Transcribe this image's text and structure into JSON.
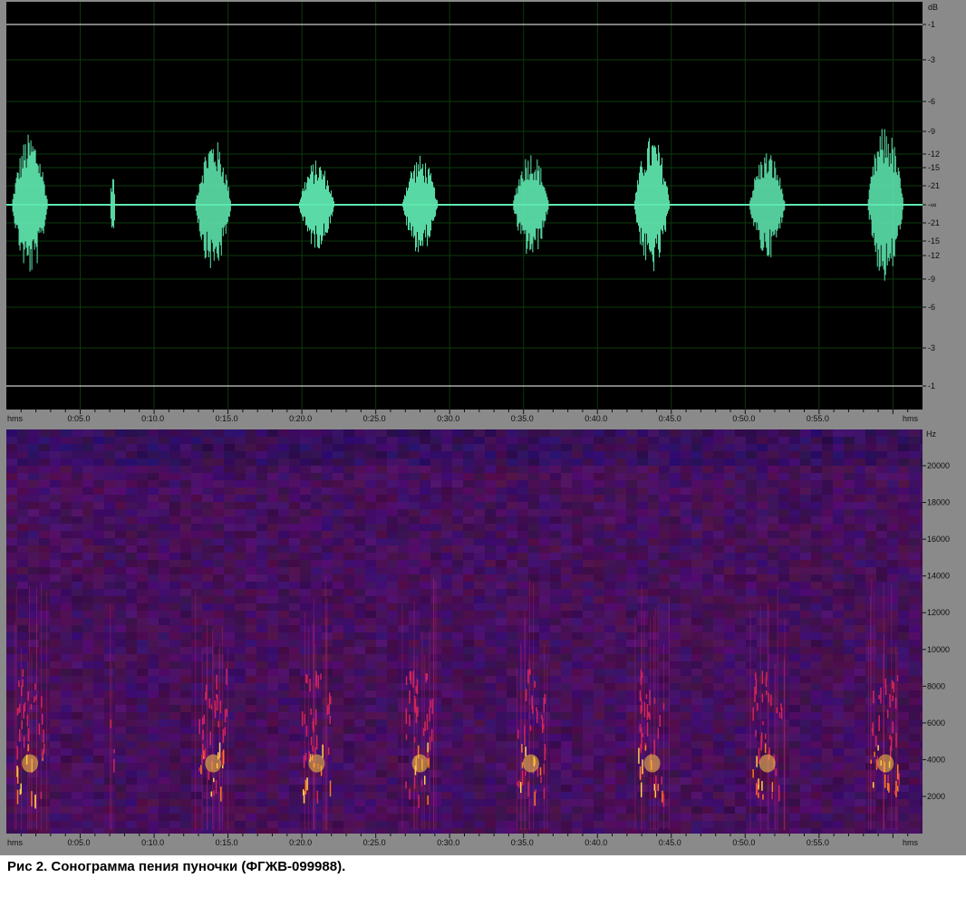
{
  "waveform": {
    "db_unit": "dB",
    "db_labels": [
      "-1",
      "-3",
      "-6",
      "-9",
      "-12",
      "-15",
      "-21",
      "-∞",
      "-21",
      "-15",
      "-12",
      "-9",
      "-6",
      "-3",
      "-1"
    ],
    "color": "#5fe8b0"
  },
  "spectrogram": {
    "freq_unit": "Hz",
    "freq_labels": [
      "20000",
      "18000",
      "16000",
      "14000",
      "12000",
      "10000",
      "8000",
      "6000",
      "4000",
      "2000"
    ]
  },
  "time_ruler": {
    "start_label": "hms",
    "end_label": "hms",
    "ticks": [
      "0:05.0",
      "0:10.0",
      "0:15.0",
      "0:20.0",
      "0:25.0",
      "0:30.0",
      "0:35.0",
      "0:40.0",
      "0:45.0",
      "0:50.0",
      "0:55.0"
    ]
  },
  "caption": "Рис 2. Сонограмма пения пуночки (ФГЖВ-099988).",
  "chart_data": {
    "type": "area",
    "x_unit": "s",
    "xlim": [
      0,
      62
    ],
    "song_bursts": [
      {
        "t": 1.6,
        "amp": 0.72
      },
      {
        "t": 7.2,
        "amp": 0.32
      },
      {
        "t": 14.0,
        "amp": 0.68
      },
      {
        "t": 21.0,
        "amp": 0.45
      },
      {
        "t": 28.0,
        "amp": 0.5
      },
      {
        "t": 35.5,
        "amp": 0.55
      },
      {
        "t": 43.7,
        "amp": 0.7
      },
      {
        "t": 51.5,
        "amp": 0.55
      },
      {
        "t": 59.5,
        "amp": 0.8
      }
    ]
  }
}
